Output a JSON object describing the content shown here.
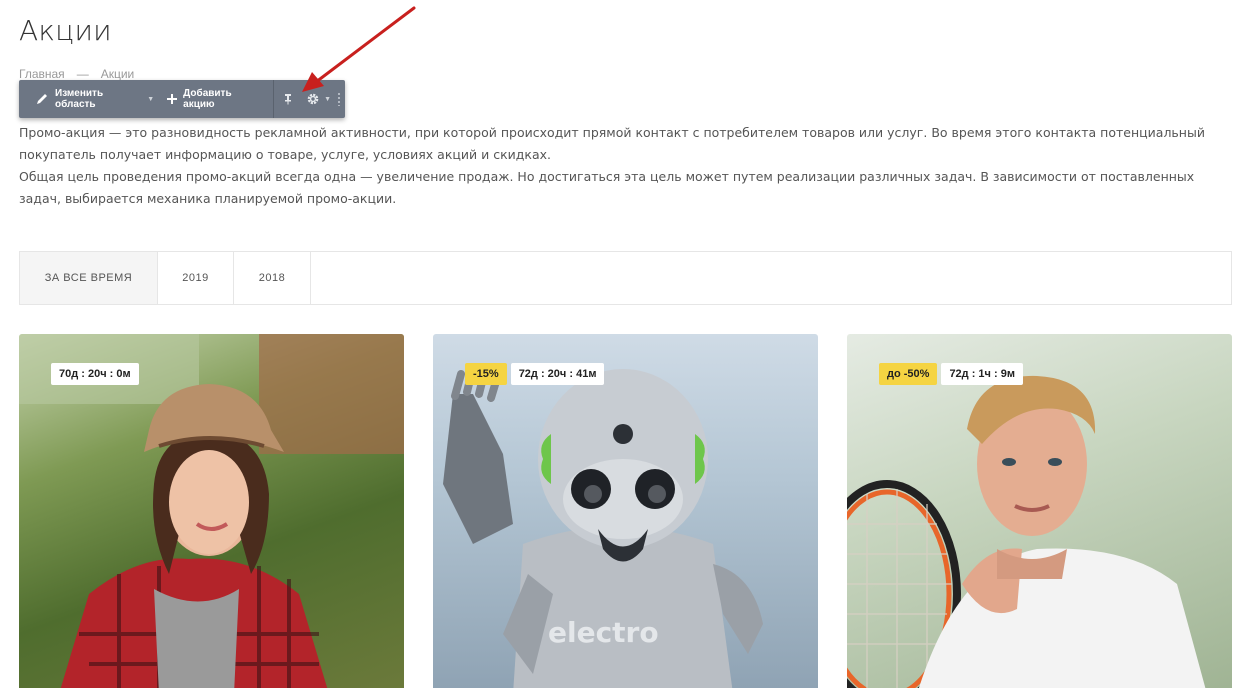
{
  "page": {
    "title": "Акции"
  },
  "breadcrumb": {
    "home": "Главная",
    "separator": "—",
    "current": "Акции"
  },
  "toolbar": {
    "edit_label": "Изменить область",
    "add_label": "Добавить акцию",
    "icons": [
      "pencil-icon",
      "plus-icon",
      "pin-icon",
      "gear-icon",
      "grip-icon"
    ]
  },
  "intro": {
    "paragraph1": "Промо-акция — это разновидность рекламной активности, при которой происходит прямой контакт с потребителем товаров или услуг. Во время этого контакта потенциальный покупатель получает информацию о товаре, услуге, условиях акций и скидках.",
    "paragraph2": "Общая цель проведения промо-акций всегда одна — увеличение продаж. Но достигаться эта цель может путем реализации различных задач. В зависимости от поставленных задач, выбирается механика планируемой промо-акции."
  },
  "filters": [
    {
      "label": "ЗА ВСЕ ВРЕМЯ",
      "active": true
    },
    {
      "label": "2019",
      "active": false
    },
    {
      "label": "2018",
      "active": false
    }
  ],
  "cards": [
    {
      "discount": "",
      "timer": "70д : 20ч : 0м",
      "image": "woman-in-hat"
    },
    {
      "discount": "-15%",
      "timer": "72д : 20ч : 41м",
      "image": "robot-electro",
      "robot_text": "electro"
    },
    {
      "discount": "до -50%",
      "timer": "72д : 1ч : 9м",
      "image": "tennis-player"
    }
  ],
  "colors": {
    "toolbar_bg": "#6d7684",
    "badge_discount": "#f5d442",
    "arrow": "#c8201e",
    "text": "#555555"
  }
}
